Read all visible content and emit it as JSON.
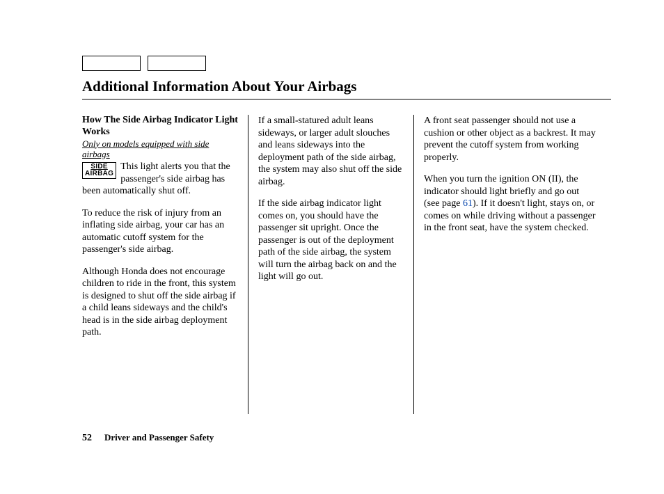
{
  "title": "Additional Information About Your Airbags",
  "col1": {
    "heading": "How The Side Airbag Indicator Light Works",
    "subnote": "Only on models equipped with side airbags",
    "icon_line1": "SIDE",
    "icon_line2": "AIRBAG",
    "p1a": "This light alerts you that the passenger's side airbag has been automatically shut off.",
    "p2": "To reduce the risk of injury from an inflating side airbag, your car has an automatic cutoff system for the passenger's side airbag.",
    "p3": "Although Honda does not encourage children to ride in the front, this system is designed to shut off the side airbag if a child leans sideways and the child's head is in the side airbag deployment path."
  },
  "col2": {
    "p1": "If a small-statured adult leans sideways, or larger adult slouches and leans sideways into the deployment path of the side airbag, the system may also shut off the side airbag.",
    "p2": "If the side airbag indicator light comes on, you should have the passenger sit upright. Once the passenger is out of the deployment path of the side airbag, the system will turn the airbag back on and the light will go out."
  },
  "col3": {
    "p1": "A front seat passenger should not use a cushion or other object as a backrest. It may prevent the cutoff system from working properly.",
    "p2a": "When you turn the ignition ON (II), the indicator should light briefly and go out (see page ",
    "link": "61",
    "p2b": "). If it doesn't light, stays on, or comes on while driving without a passenger in the front seat, have the system checked."
  },
  "footer": {
    "page": "52",
    "text": "Driver and Passenger Safety"
  }
}
